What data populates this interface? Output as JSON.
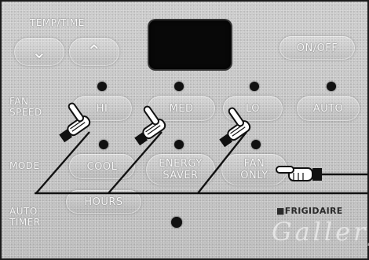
{
  "labels": {
    "temp_time": "TEMP/TIME",
    "fan_speed": "FAN\nSPEED",
    "mode": "MODE",
    "auto_timer": "AUTO\nTIMER",
    "brand": "■FRIGIDAIRE",
    "brand_sub": "Gallery"
  },
  "buttons": {
    "down": "⌄",
    "up": "⌃",
    "on_off": "ON/OFF",
    "hi": "HI",
    "med": "MED",
    "lo": "LO",
    "auto": "AUTO",
    "cool": "COOL",
    "energy_saver": "ENERGY\nSAVER",
    "fan_only": "FAN\nONLY",
    "hours": "HOURS"
  }
}
